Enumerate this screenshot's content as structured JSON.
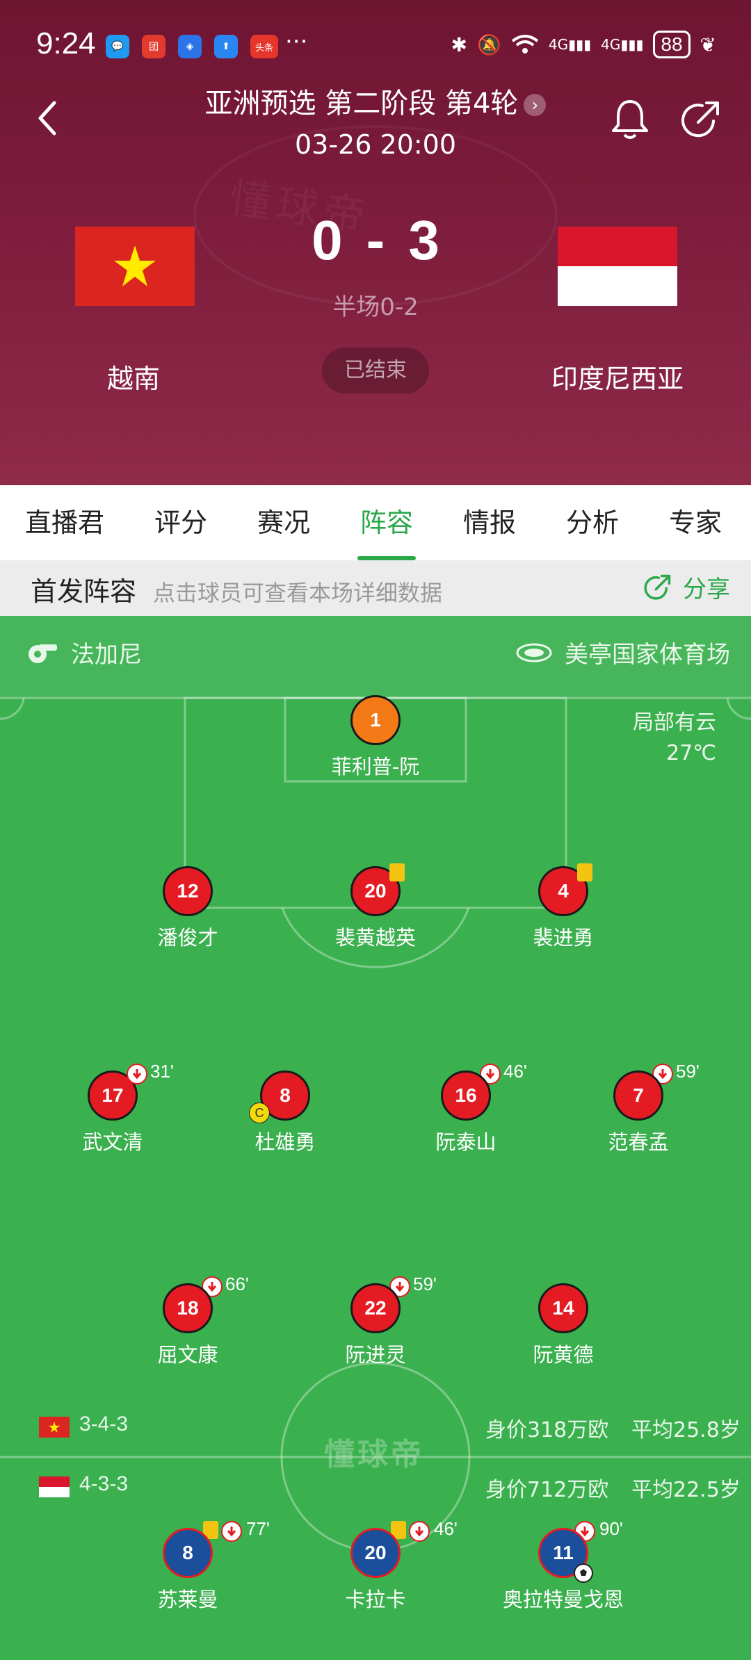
{
  "status_bar": {
    "time": "9:24",
    "apps": [
      {
        "icon": "chat-app-icon",
        "color": "#1e9bf0",
        "glyph": "💬"
      },
      {
        "icon": "store-app-icon",
        "color": "#e23a2e",
        "glyph": "团"
      },
      {
        "icon": "shield-app-icon",
        "color": "#2a74e8",
        "glyph": "◈"
      },
      {
        "icon": "upload-app-icon",
        "color": "#2a86f0",
        "glyph": "⬆"
      },
      {
        "icon": "news-app-icon",
        "color": "#e6352b",
        "glyph": "头条"
      }
    ],
    "more": "···",
    "network_1": "4G",
    "network_2": "4G",
    "battery": "88"
  },
  "header": {
    "title": "亚洲预选 第二阶段 第4轮",
    "datetime": "03-26 20:00",
    "home_team": "越南",
    "away_team": "印度尼西亚",
    "home_score": "0",
    "separator": "-",
    "away_score": "3",
    "half_time": "半场0-2",
    "status": "已结束"
  },
  "tabs": [
    {
      "label": "直播君",
      "active": false
    },
    {
      "label": "评分",
      "active": false
    },
    {
      "label": "赛况",
      "active": false
    },
    {
      "label": "阵容",
      "active": true
    },
    {
      "label": "情报",
      "active": false
    },
    {
      "label": "分析",
      "active": false
    },
    {
      "label": "专家",
      "active": false
    }
  ],
  "lineup_header": {
    "title": "首发阵容",
    "hint": "点击球员可查看本场详细数据",
    "share_label": "分享"
  },
  "pitch": {
    "referee": "法加尼",
    "venue": "美亭国家体育场",
    "weather": "局部有云",
    "temperature": "27℃",
    "watermark": "懂球帝"
  },
  "home_players": [
    {
      "number": "1",
      "name": "菲利普-阮",
      "color": "orange"
    },
    {
      "number": "12",
      "name": "潘俊才"
    },
    {
      "number": "20",
      "name": "裴黄越英",
      "yellow_card": true
    },
    {
      "number": "4",
      "name": "裴进勇",
      "yellow_card": true
    },
    {
      "number": "17",
      "name": "武文清",
      "sub_minute": "31'"
    },
    {
      "number": "8",
      "name": "杜雄勇",
      "captain": "C"
    },
    {
      "number": "16",
      "name": "阮泰山",
      "sub_minute": "46'"
    },
    {
      "number": "7",
      "name": "范春孟",
      "sub_minute": "59'"
    },
    {
      "number": "18",
      "name": "屈文康",
      "sub_minute": "66'"
    },
    {
      "number": "22",
      "name": "阮进灵",
      "sub_minute": "59'"
    },
    {
      "number": "14",
      "name": "阮黄德"
    }
  ],
  "away_players": [
    {
      "number": "8",
      "name": "苏莱曼",
      "yellow_card": true,
      "sub_minute": "77'"
    },
    {
      "number": "20",
      "name": "卡拉卡",
      "yellow_card": true,
      "sub_minute": "46'"
    },
    {
      "number": "11",
      "name": "奥拉特曼戈恩",
      "sub_minute": "90'",
      "goal": true
    }
  ],
  "home_summary": {
    "formation": "3-4-3",
    "market_value": "身价318万欧",
    "avg_age": "平均25.8岁"
  },
  "away_summary": {
    "formation": "4-3-3",
    "market_value": "身价712万欧",
    "avg_age": "平均22.5岁"
  },
  "colors": {
    "pitch": "#3bb04f",
    "accent": "#2ba84a",
    "home_kit": "#e51b24",
    "away_kit": "#1b4f9c",
    "header": "#7d1c3c"
  }
}
